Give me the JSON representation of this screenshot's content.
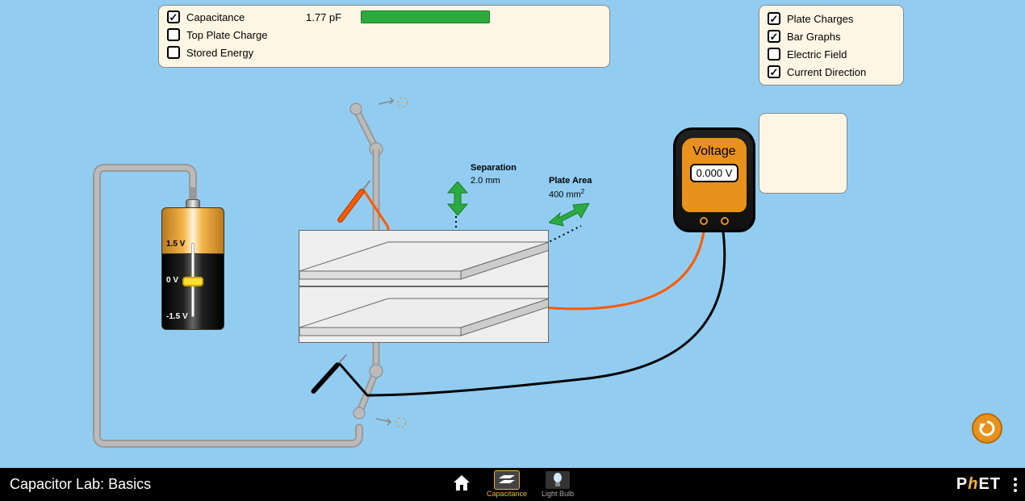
{
  "title": "Capacitor Lab: Basics",
  "meters": [
    {
      "label": "Capacitance",
      "checked": true,
      "value": "1.77 pF",
      "bar": true
    },
    {
      "label": "Top Plate Charge",
      "checked": false
    },
    {
      "label": "Stored Energy",
      "checked": false
    }
  ],
  "options": [
    {
      "label": "Plate Charges",
      "checked": true
    },
    {
      "label": "Bar Graphs",
      "checked": true
    },
    {
      "label": "Electric Field",
      "checked": false
    },
    {
      "label": "Current Direction",
      "checked": true
    }
  ],
  "battery": {
    "hi": "1.5 V",
    "mid": "0 V",
    "lo": "-1.5 V"
  },
  "separation": {
    "label": "Separation",
    "value": "2.0 mm"
  },
  "plateArea": {
    "label": "Plate Area",
    "value": "400 mm",
    "sup": "2"
  },
  "voltmeter": {
    "label": "Voltage",
    "reading": "0.000 V"
  },
  "screens": {
    "capacitance": "Capacitance",
    "lightbulb": "Light Bulb"
  },
  "logo": {
    "p": "P",
    "h": "h",
    "et": "ET"
  }
}
